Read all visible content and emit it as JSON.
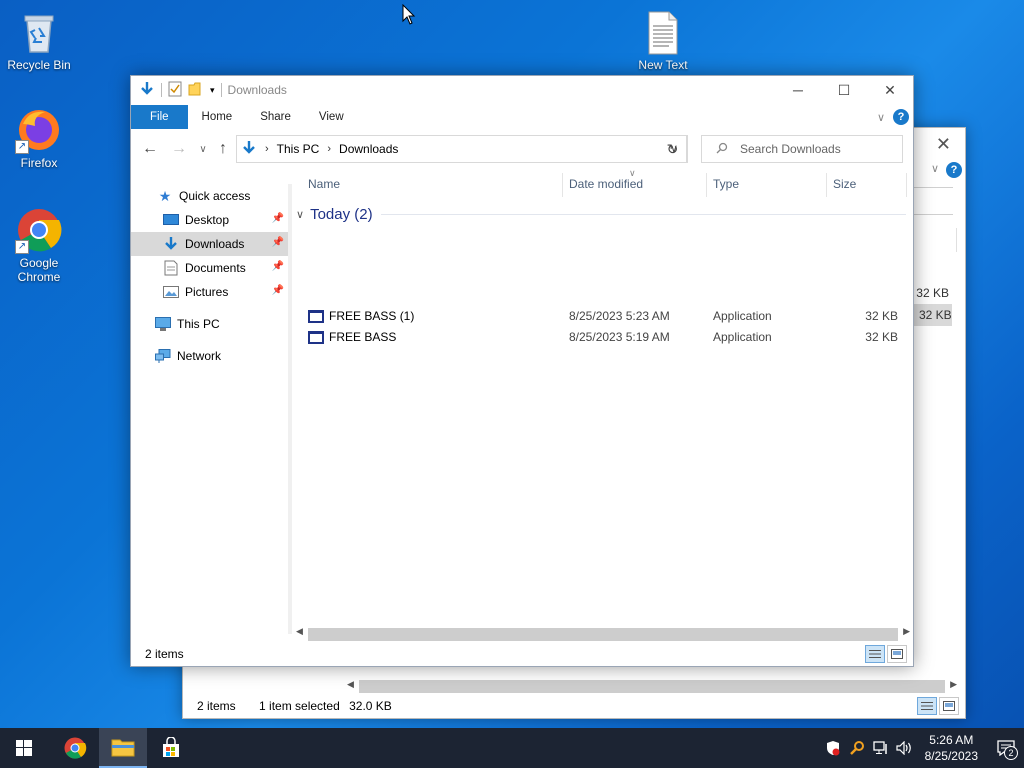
{
  "desktop": {
    "icons": [
      {
        "label": "Recycle Bin",
        "icon": "recycle-bin-icon"
      },
      {
        "label": "Firefox",
        "icon": "firefox-icon"
      },
      {
        "label": "Google Chrome",
        "icon": "chrome-icon"
      },
      {
        "label": "New Text",
        "icon": "text-file-icon"
      }
    ]
  },
  "back_window": {
    "size_rows": [
      "32 KB",
      "32 KB"
    ],
    "status": {
      "count": "2 items",
      "selection": "1 item selected",
      "size": "32.0 KB"
    }
  },
  "window": {
    "title": "Downloads",
    "ribbon_tabs": [
      "File",
      "Home",
      "Share",
      "View"
    ],
    "address": {
      "crumbs": [
        "This PC",
        "Downloads"
      ]
    },
    "search_placeholder": "Search Downloads",
    "nav_pane": [
      {
        "label": "Quick access",
        "icon": "star-icon"
      },
      {
        "label": "Desktop",
        "icon": "desktop-icon",
        "pinned": true
      },
      {
        "label": "Downloads",
        "icon": "download-arrow-icon",
        "pinned": true,
        "selected": true
      },
      {
        "label": "Documents",
        "icon": "documents-icon",
        "pinned": true
      },
      {
        "label": "Pictures",
        "icon": "pictures-icon",
        "pinned": true
      },
      {
        "label": "This PC",
        "icon": "computer-icon"
      },
      {
        "label": "Network",
        "icon": "network-icon"
      }
    ],
    "columns": [
      "Name",
      "Date modified",
      "Type",
      "Size"
    ],
    "group": "Today (2)",
    "files": [
      {
        "name": "FREE BASS (1)",
        "date": "8/25/2023 5:23 AM",
        "type": "Application",
        "size": "32 KB"
      },
      {
        "name": "FREE BASS",
        "date": "8/25/2023 5:19 AM",
        "type": "Application",
        "size": "32 KB"
      }
    ],
    "status": "2 items"
  },
  "taskbar": {
    "apps": [
      "start-icon",
      "chrome-icon",
      "file-explorer-icon",
      "store-icon"
    ],
    "clock": {
      "time": "5:26 AM",
      "date": "8/25/2023"
    },
    "notifications": "2"
  }
}
